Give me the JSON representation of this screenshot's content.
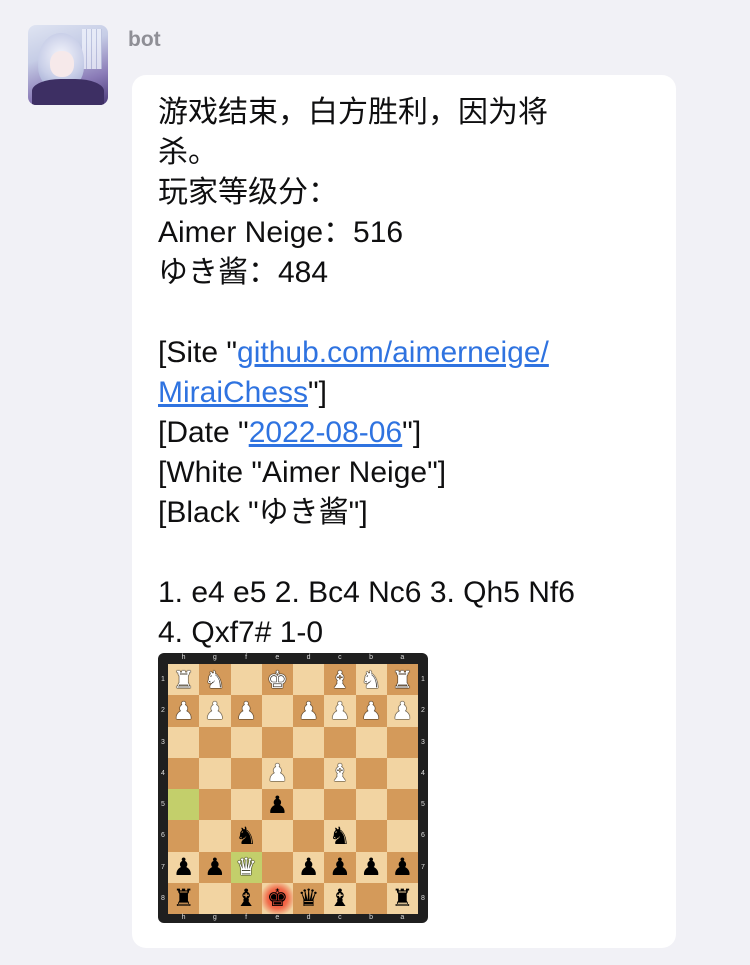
{
  "sender": {
    "name": "bot"
  },
  "message": {
    "result_line_1": "游戏结束，白方胜利，因为将",
    "result_line_2": "杀。",
    "ratings_heading": "玩家等级分：",
    "player1": "Aimer Neige：516",
    "player2": "ゆき酱：484",
    "pgn": {
      "site_prefix": "[Site \"",
      "site_link_1": "github.com/aimerneige/",
      "site_link_2": "MiraiChess",
      "site_suffix": "\"]",
      "date_prefix": "[Date \"",
      "date_link": "2022-08-06",
      "date_suffix": "\"]",
      "white": "[White \"Aimer Neige\"]",
      "black": "[Black \"ゆき酱\"]"
    },
    "moves_line_1": "1. e4 e5 2. Bc4 Nc6 3. Qh5 Nf6",
    "moves_line_2": "4. Qxf7# 1-0"
  },
  "board": {
    "files": [
      "h",
      "g",
      "f",
      "e",
      "d",
      "c",
      "b",
      "a"
    ],
    "ranks": [
      "1",
      "2",
      "3",
      "4",
      "5",
      "6",
      "7",
      "8"
    ],
    "rows": [
      [
        "wR",
        "wN",
        "",
        "wK",
        "",
        "wB",
        "wN",
        "wR"
      ],
      [
        "wP",
        "wP",
        "wP",
        "",
        "wP",
        "wP",
        "wP",
        "wP"
      ],
      [
        "",
        "",
        "",
        "",
        "",
        "",
        "",
        ""
      ],
      [
        "",
        "",
        "",
        "wP",
        "",
        "wB",
        "",
        ""
      ],
      [
        "",
        "",
        "",
        "bP",
        "",
        "",
        "",
        ""
      ],
      [
        "",
        "",
        "bN",
        "",
        "",
        "bN",
        "",
        ""
      ],
      [
        "bP",
        "bP",
        "wQ",
        "",
        "bP",
        "bP",
        "bP",
        "bP"
      ],
      [
        "bR",
        "",
        "bB",
        "bK",
        "bQ",
        "bB",
        "",
        "bR"
      ]
    ],
    "highlight_squares": [
      "f7",
      "h5"
    ],
    "check_square": "e8",
    "colors": {
      "light": "#f2d4a2",
      "dark": "#d49a5a",
      "highlight": "#c3cf6b",
      "check": "#ff3b2f"
    }
  }
}
